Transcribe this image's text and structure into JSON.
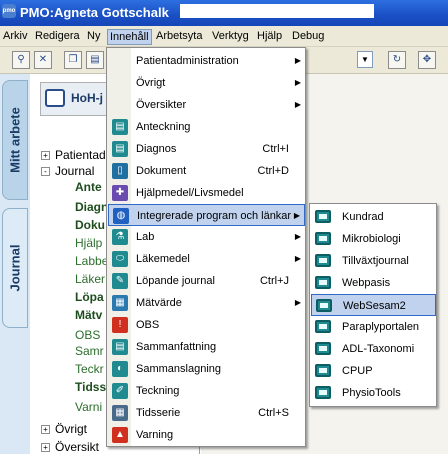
{
  "window": {
    "title": "PMO:Agneta Gottschalk",
    "app_icon": "pmo"
  },
  "menubar": [
    {
      "label": "Arkiv",
      "open": false
    },
    {
      "label": "Redigera",
      "open": false
    },
    {
      "label": "Ny",
      "open": false
    },
    {
      "label": "Innehåll",
      "open": true
    },
    {
      "label": "Arbetsyta",
      "open": false
    },
    {
      "label": "Verktyg",
      "open": false
    },
    {
      "label": "Hjälp",
      "open": false
    },
    {
      "label": "Debug",
      "open": false
    }
  ],
  "toolbar": {
    "icons": [
      "search-icon",
      "close-icon",
      "copy-icon",
      "document-icon",
      "refresh-icon",
      "move-icon"
    ]
  },
  "left_tabs": [
    {
      "label": "Mitt arbete",
      "active": false
    },
    {
      "label": "Journal",
      "active": true
    }
  ],
  "nav": {
    "header_title": "HoH-j",
    "tree": [
      {
        "label": "Patientad",
        "toggle": "+",
        "style": "normal"
      },
      {
        "label": "Journal",
        "toggle": "-",
        "style": "normal"
      },
      {
        "label": "Ante",
        "toggle": "",
        "style": "bold"
      },
      {
        "label": "Diagn",
        "toggle": "",
        "style": "bold"
      },
      {
        "label": "Doku",
        "toggle": "",
        "style": "bold"
      },
      {
        "label": "Hjälp",
        "toggle": "",
        "style": "green"
      },
      {
        "label": "Labbe",
        "toggle": "",
        "style": "green"
      },
      {
        "label": "Läker",
        "toggle": "",
        "style": "green"
      },
      {
        "label": "Löpa",
        "toggle": "",
        "style": "bold"
      },
      {
        "label": "Mätv",
        "toggle": "",
        "style": "bold"
      },
      {
        "label": "OBS",
        "toggle": "",
        "style": "green"
      },
      {
        "label": "Samr",
        "toggle": "",
        "style": "green"
      },
      {
        "label": "Teckr",
        "toggle": "",
        "style": "green"
      },
      {
        "label": "Tidss",
        "toggle": "",
        "style": "bold"
      },
      {
        "label": "Varni",
        "toggle": "",
        "style": "green"
      },
      {
        "label": "Övrigt",
        "toggle": "+",
        "style": "normal"
      },
      {
        "label": "Översikt",
        "toggle": "+",
        "style": "normal"
      }
    ]
  },
  "innehall_menu": [
    {
      "label": "Patientadministration",
      "shortcut": "",
      "submenu": true,
      "icon": "none",
      "highlighted": false
    },
    {
      "label": "Övrigt",
      "shortcut": "",
      "submenu": true,
      "icon": "none",
      "highlighted": false
    },
    {
      "label": "Översikter",
      "shortcut": "",
      "submenu": true,
      "icon": "none",
      "highlighted": false
    },
    {
      "label": "Anteckning",
      "shortcut": "",
      "submenu": false,
      "icon": "note-icon",
      "highlighted": false
    },
    {
      "label": "Diagnos",
      "shortcut": "Ctrl+I",
      "submenu": false,
      "icon": "diagnosis-icon",
      "highlighted": false
    },
    {
      "label": "Dokument",
      "shortcut": "Ctrl+D",
      "submenu": false,
      "icon": "document-icon",
      "highlighted": false
    },
    {
      "label": "Hjälpmedel/Livsmedel",
      "shortcut": "",
      "submenu": false,
      "icon": "aid-icon",
      "highlighted": false
    },
    {
      "label": "Integrerade program och länkar",
      "shortcut": "",
      "submenu": true,
      "icon": "globe-icon",
      "highlighted": true
    },
    {
      "label": "Lab",
      "shortcut": "",
      "submenu": true,
      "icon": "lab-icon",
      "highlighted": false
    },
    {
      "label": "Läkemedel",
      "shortcut": "",
      "submenu": true,
      "icon": "medicine-icon",
      "highlighted": false
    },
    {
      "label": "Löpande journal",
      "shortcut": "Ctrl+J",
      "submenu": false,
      "icon": "journal-icon",
      "highlighted": false
    },
    {
      "label": "Mätvärde",
      "shortcut": "",
      "submenu": true,
      "icon": "measure-icon",
      "highlighted": false
    },
    {
      "label": "OBS",
      "shortcut": "",
      "submenu": false,
      "icon": "alert-icon",
      "highlighted": false
    },
    {
      "label": "Sammanfattning",
      "shortcut": "",
      "submenu": false,
      "icon": "summary-icon",
      "highlighted": false
    },
    {
      "label": "Sammanslagning",
      "shortcut": "",
      "submenu": false,
      "icon": "merge-icon",
      "highlighted": false
    },
    {
      "label": "Teckning",
      "shortcut": "",
      "submenu": false,
      "icon": "drawing-icon",
      "highlighted": false
    },
    {
      "label": "Tidsserie",
      "shortcut": "Ctrl+S",
      "submenu": false,
      "icon": "timeseries-icon",
      "highlighted": false
    },
    {
      "label": "Varning",
      "shortcut": "",
      "submenu": false,
      "icon": "warning-icon",
      "highlighted": false
    }
  ],
  "integrerade_submenu": [
    {
      "label": "Kundrad",
      "highlighted": false
    },
    {
      "label": "Mikrobiologi",
      "highlighted": false
    },
    {
      "label": "Tillväxtjournal",
      "highlighted": false
    },
    {
      "label": "Webpasis",
      "highlighted": false
    },
    {
      "label": "WebSesam2",
      "highlighted": true
    },
    {
      "label": "Paraplyportalen",
      "highlighted": false
    },
    {
      "label": "ADL-Taxonomi",
      "highlighted": false
    },
    {
      "label": "CPUP",
      "highlighted": false
    },
    {
      "label": "PhysioTools",
      "highlighted": false
    }
  ],
  "colors": {
    "titlebar": "#1a4fc4",
    "menu_highlight": "#c1d2ee",
    "menu_highlight_border": "#316ac5",
    "submenu_icon": "#1f8a90"
  }
}
